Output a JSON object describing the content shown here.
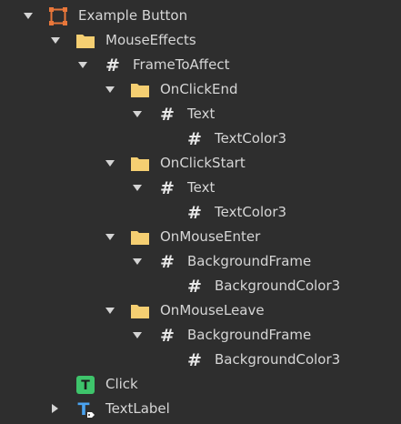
{
  "explorer": {
    "items": [
      {
        "label": "Example Button",
        "icon": "frame-icon",
        "expanded": true
      },
      {
        "label": "MouseEffects",
        "icon": "folder-icon",
        "expanded": true
      },
      {
        "label": "FrameToAffect",
        "icon": "value-icon",
        "icon_glyph": "#",
        "expanded": true
      },
      {
        "label": "OnClickEnd",
        "icon": "folder-icon",
        "expanded": true
      },
      {
        "label": "Text",
        "icon": "value-icon",
        "icon_glyph": "#",
        "expanded": true
      },
      {
        "label": "TextColor3",
        "icon": "value-icon",
        "icon_glyph": "#"
      },
      {
        "label": "OnClickStart",
        "icon": "folder-icon",
        "expanded": true
      },
      {
        "label": "Text",
        "icon": "value-icon",
        "icon_glyph": "#",
        "expanded": true
      },
      {
        "label": "TextColor3",
        "icon": "value-icon",
        "icon_glyph": "#"
      },
      {
        "label": "OnMouseEnter",
        "icon": "folder-icon",
        "expanded": true
      },
      {
        "label": "BackgroundFrame",
        "icon": "value-icon",
        "icon_glyph": "#",
        "expanded": true
      },
      {
        "label": "BackgroundColor3",
        "icon": "value-icon",
        "icon_glyph": "#"
      },
      {
        "label": "OnMouseLeave",
        "icon": "folder-icon",
        "expanded": true
      },
      {
        "label": "BackgroundFrame",
        "icon": "value-icon",
        "icon_glyph": "#",
        "expanded": true
      },
      {
        "label": "BackgroundColor3",
        "icon": "value-icon",
        "icon_glyph": "#"
      },
      {
        "label": "Click",
        "icon": "script-icon",
        "icon_glyph": "T"
      },
      {
        "label": "TextLabel",
        "icon": "textlabel-icon",
        "icon_glyph": "T",
        "expanded": false
      }
    ]
  },
  "colors": {
    "background": "#2e2e2e",
    "text": "#d6d6d6",
    "frame_icon": "#e9773a",
    "folder_icon": "#f5cf72",
    "script_icon": "#3ec46b",
    "textlabel_icon": "#4aa3f0"
  }
}
